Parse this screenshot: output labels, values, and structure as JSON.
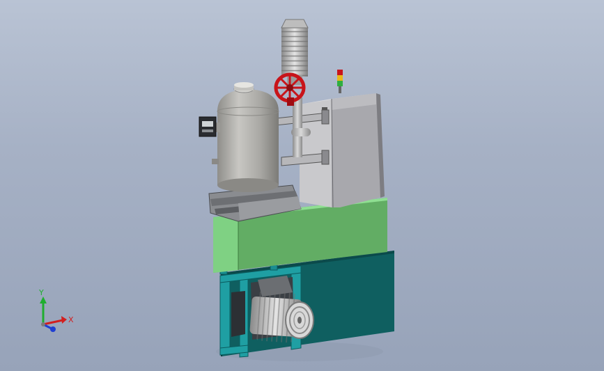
{
  "colors": {
    "background_top": "#b9c3d4",
    "background_bottom": "#97a3b9",
    "cabinet_green": "#6fbf73",
    "cabinet_teal": "#0f5f60",
    "frame_teal": "#1f9fa3",
    "control_box": "#b8b8bc",
    "tank_metal": "#a9a8a4",
    "valve_red": "#c8141a",
    "axis_x": "#d21f1f",
    "axis_y": "#1fae2f",
    "axis_z": "#1f3fd2"
  },
  "triad": {
    "x_label": "X",
    "y_label": "Y"
  }
}
